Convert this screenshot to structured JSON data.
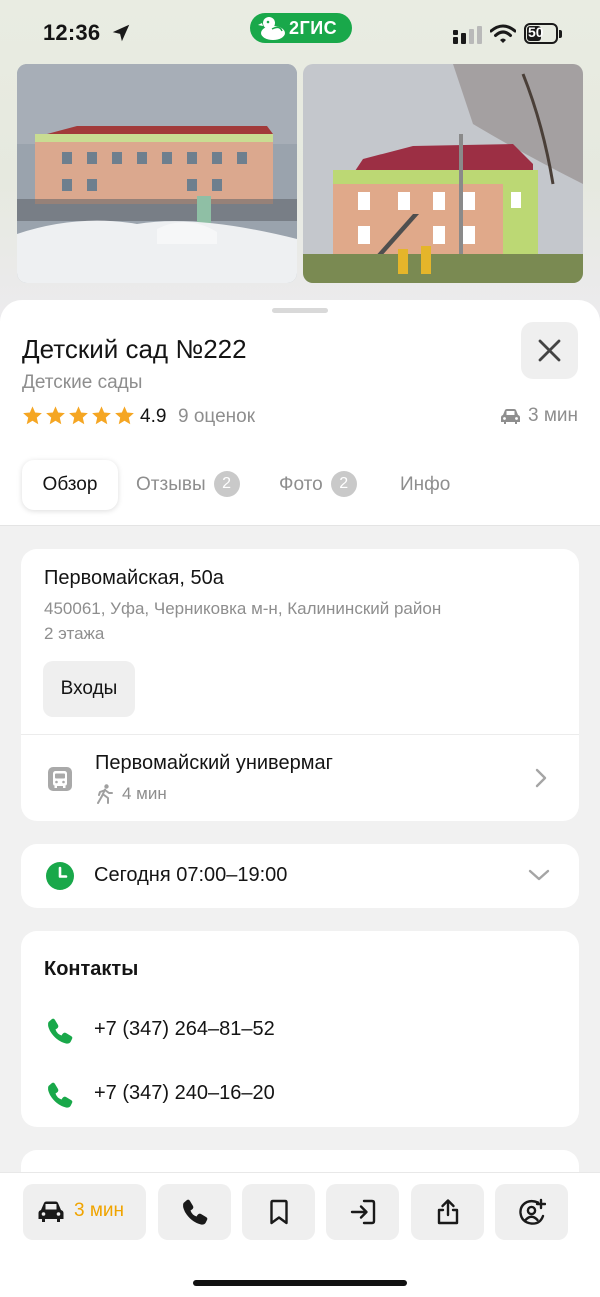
{
  "status_bar": {
    "time": "12:36",
    "brand": "2ГИС",
    "battery": "50",
    "battery_level": 0.5
  },
  "place": {
    "title": "Детский сад №222",
    "category": "Детские сады",
    "rating": "4.9",
    "rating_stars": 5,
    "ratings_count": "9 оценок",
    "drive_time": "3 мин"
  },
  "tabs": [
    {
      "label": "Обзор",
      "badge": ""
    },
    {
      "label": "Отзывы",
      "badge": "2"
    },
    {
      "label": "Фото",
      "badge": "2"
    },
    {
      "label": "Инфо",
      "badge": ""
    }
  ],
  "address": {
    "street": "Первомайская, 50а",
    "details": "450061, Уфа, Черниковка м-н, Калининский район",
    "floors": "2 этажа",
    "entrances_label": "Входы"
  },
  "transit": {
    "stop_name": "Первомайский универмаг",
    "walk_time": "4 мин"
  },
  "hours": {
    "text": "Сегодня 07:00–19:00"
  },
  "contacts": {
    "title": "Контакты",
    "phones": [
      "+7 (347) 264–81–52",
      "+7 (347) 240–16–20"
    ]
  },
  "action_bar": {
    "route_time": "3 мин"
  },
  "colors": {
    "brand_green": "#19a84a",
    "star": "#f5a623",
    "accent_orange": "#f0a400",
    "muted": "#8e8e8e"
  },
  "icons": [
    "location-arrow-icon",
    "signal-icon",
    "wifi-icon",
    "battery-icon",
    "close-icon",
    "star-icon",
    "car-icon",
    "bus-icon",
    "walk-icon",
    "chevron-right-icon",
    "clock-icon",
    "chevron-down-icon",
    "phone-icon",
    "bookmark-icon",
    "enter-icon",
    "share-icon",
    "add-friend-icon"
  ]
}
